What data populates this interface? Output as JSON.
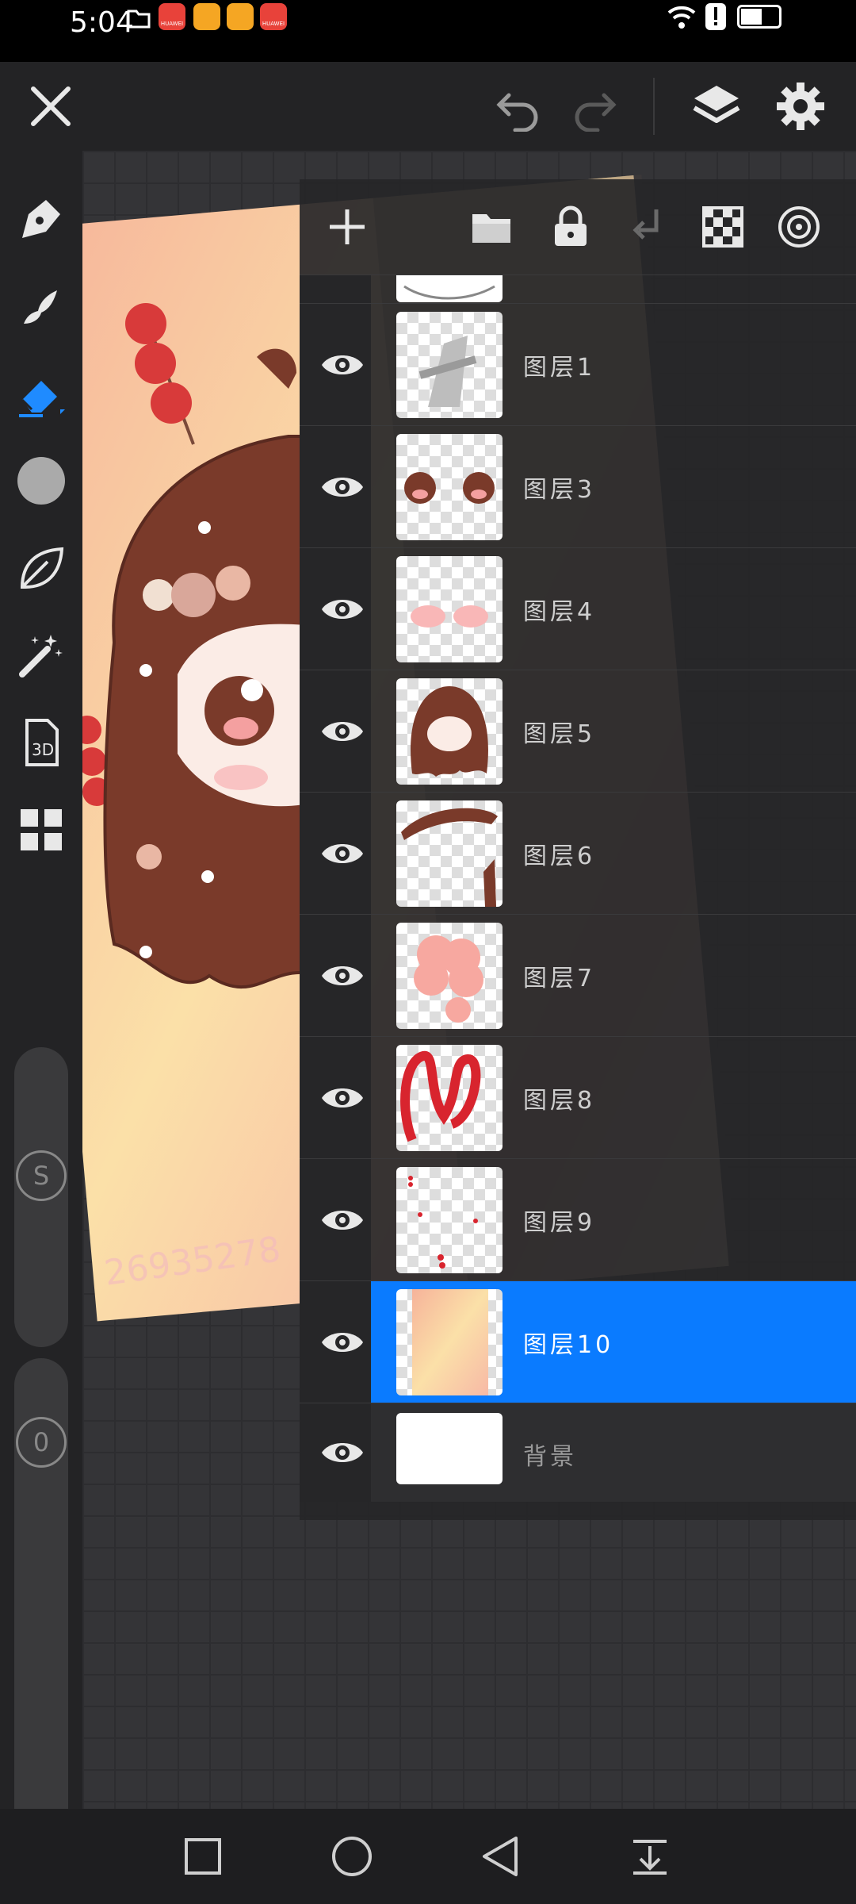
{
  "status_bar": {
    "time": "5:04",
    "app_icon_labels": [
      "HUAWEI",
      "HUAWEI"
    ]
  },
  "toolbar": {
    "close": "close-icon",
    "undo": "undo-icon",
    "redo": "redo-icon",
    "layers": "layers-icon",
    "settings": "gear-icon"
  },
  "left_tools": [
    "pen-icon",
    "smudge-icon",
    "eraser-icon",
    "color-circle-icon",
    "leaf-icon",
    "magic-wand-icon",
    "3d-icon",
    "grid-icon"
  ],
  "left_sliders": {
    "size_label": "S",
    "opacity_label": "0"
  },
  "canvas": {
    "watermark": "26935278"
  },
  "layers_panel": {
    "toolbar": [
      "add-icon",
      "folder-icon",
      "lock-icon",
      "merge-down-icon",
      "checker-icon",
      "target-icon"
    ],
    "layers": [
      {
        "name": "图层1",
        "visible": true
      },
      {
        "name": "图层3",
        "visible": true
      },
      {
        "name": "图层4",
        "visible": true
      },
      {
        "name": "图层5",
        "visible": true
      },
      {
        "name": "图层6",
        "visible": true
      },
      {
        "name": "图层7",
        "visible": true
      },
      {
        "name": "图层8",
        "visible": true
      },
      {
        "name": "图层9",
        "visible": true
      },
      {
        "name": "图层10",
        "visible": true,
        "selected": true
      },
      {
        "name": "背景",
        "visible": true
      }
    ]
  },
  "colors": {
    "accent": "#0a7bff",
    "panel": "#262628"
  }
}
